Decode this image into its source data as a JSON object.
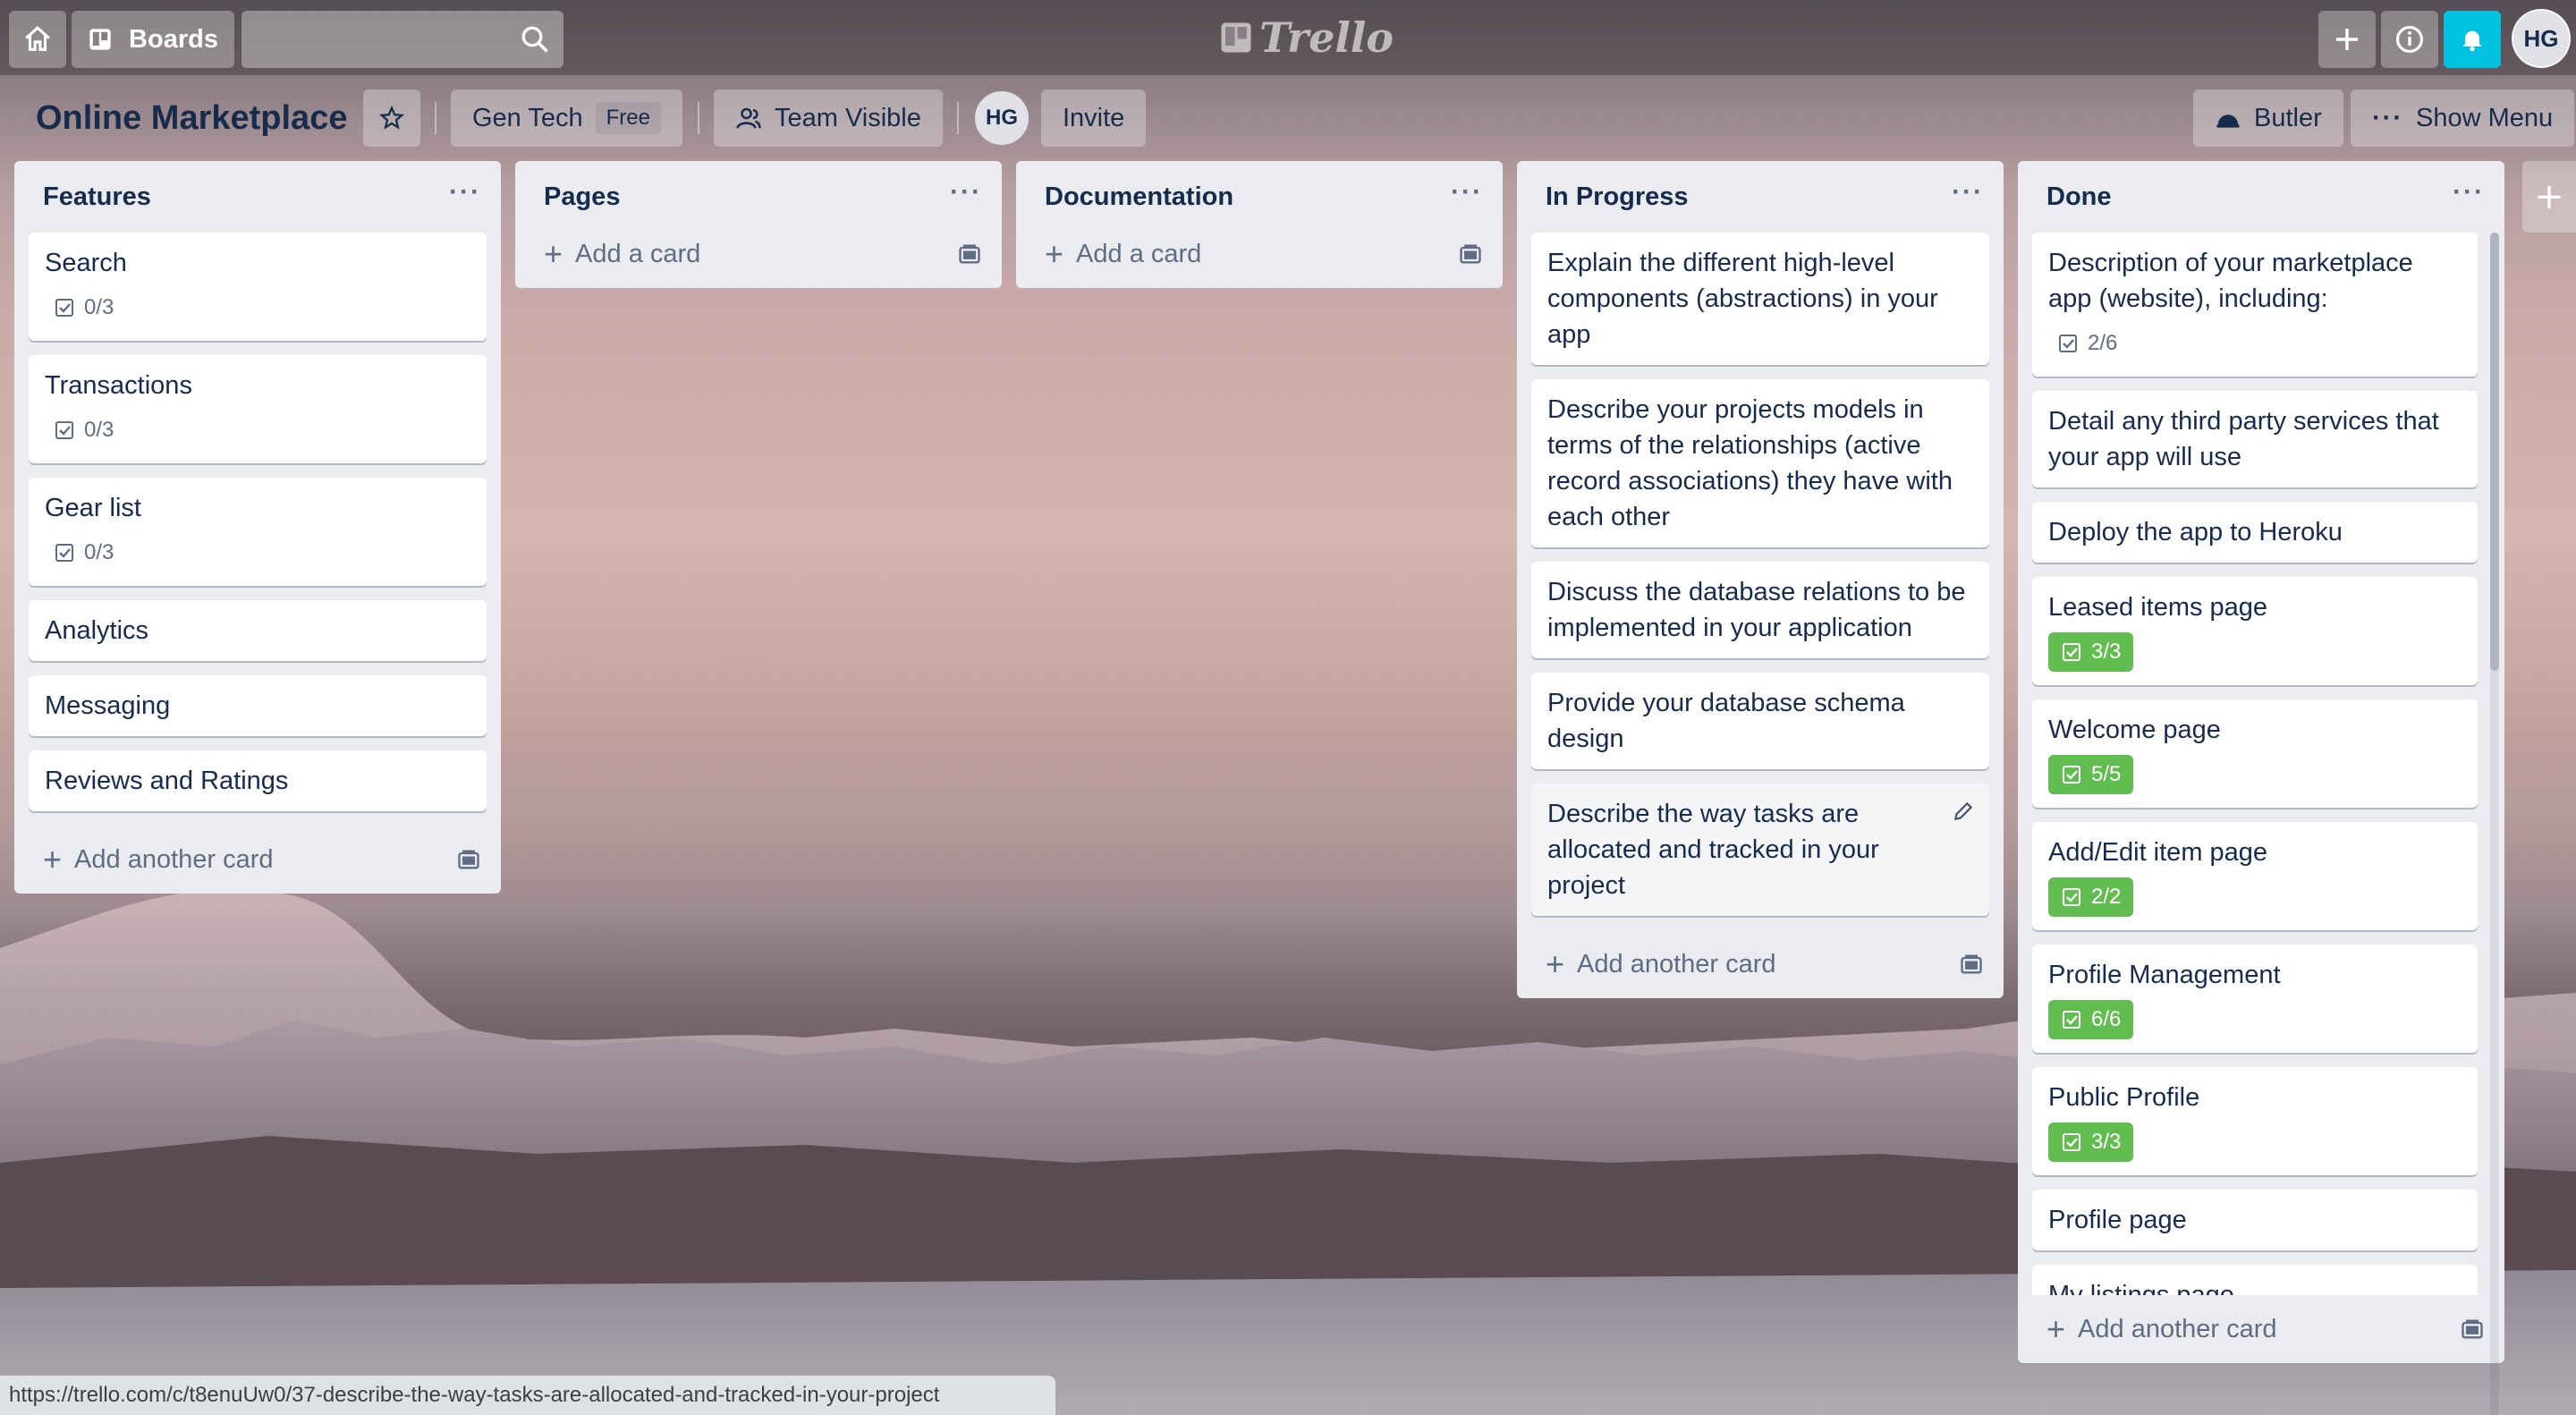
{
  "topbar": {
    "boards_label": "Boards",
    "logo_text": "Trello",
    "avatar_initials": "HG",
    "notification_color": "#00c2e0"
  },
  "board": {
    "title": "Online Marketplace",
    "team_name": "Gen Tech",
    "plan": "Free",
    "visibility": "Team Visible",
    "member_initials": "HG",
    "invite_label": "Invite",
    "butler_label": "Butler",
    "show_menu_label": "Show Menu"
  },
  "lists": [
    {
      "title": "Features",
      "add_label": "Add another card",
      "cards": [
        {
          "title": "Search",
          "badge": "0/3"
        },
        {
          "title": "Transactions",
          "badge": "0/3"
        },
        {
          "title": "Gear list",
          "badge": "0/3"
        },
        {
          "title": "Analytics"
        },
        {
          "title": "Messaging"
        },
        {
          "title": "Reviews and Ratings"
        }
      ]
    },
    {
      "title": "Pages",
      "add_label": "Add a card",
      "cards": []
    },
    {
      "title": "Documentation",
      "add_label": "Add a card",
      "cards": []
    },
    {
      "title": "In Progress",
      "add_label": "Add another card",
      "cards": [
        {
          "title": "Explain the different high-level components (abstractions) in your app"
        },
        {
          "title": "Describe your projects models in terms of the relationships (active record associations) they have with each other"
        },
        {
          "title": "Discuss the database relations to be implemented in your application"
        },
        {
          "title": "Provide your database schema design"
        },
        {
          "title": "Describe the way tasks are allocated and tracked in your project"
        }
      ]
    },
    {
      "title": "Done",
      "add_label": "Add another card",
      "cards": [
        {
          "title": "Description of your marketplace app (website), including:",
          "badge": "2/6"
        },
        {
          "title": "Detail any third party services that your app will use"
        },
        {
          "title": "Deploy the app to Heroku"
        },
        {
          "title": "Leased items page",
          "badge": "3/3",
          "complete": true
        },
        {
          "title": "Welcome page",
          "badge": "5/5",
          "complete": true
        },
        {
          "title": "Add/Edit item page",
          "badge": "2/2",
          "complete": true
        },
        {
          "title": "Profile Management",
          "badge": "6/6",
          "complete": true
        },
        {
          "title": "Public Profile",
          "badge": "3/3",
          "complete": true
        },
        {
          "title": "Profile page"
        },
        {
          "title": "My listings page"
        }
      ]
    }
  ],
  "status_url": "https://trello.com/c/t8enuUw0/37-describe-the-way-tasks-are-allocated-and-tracked-in-your-project"
}
